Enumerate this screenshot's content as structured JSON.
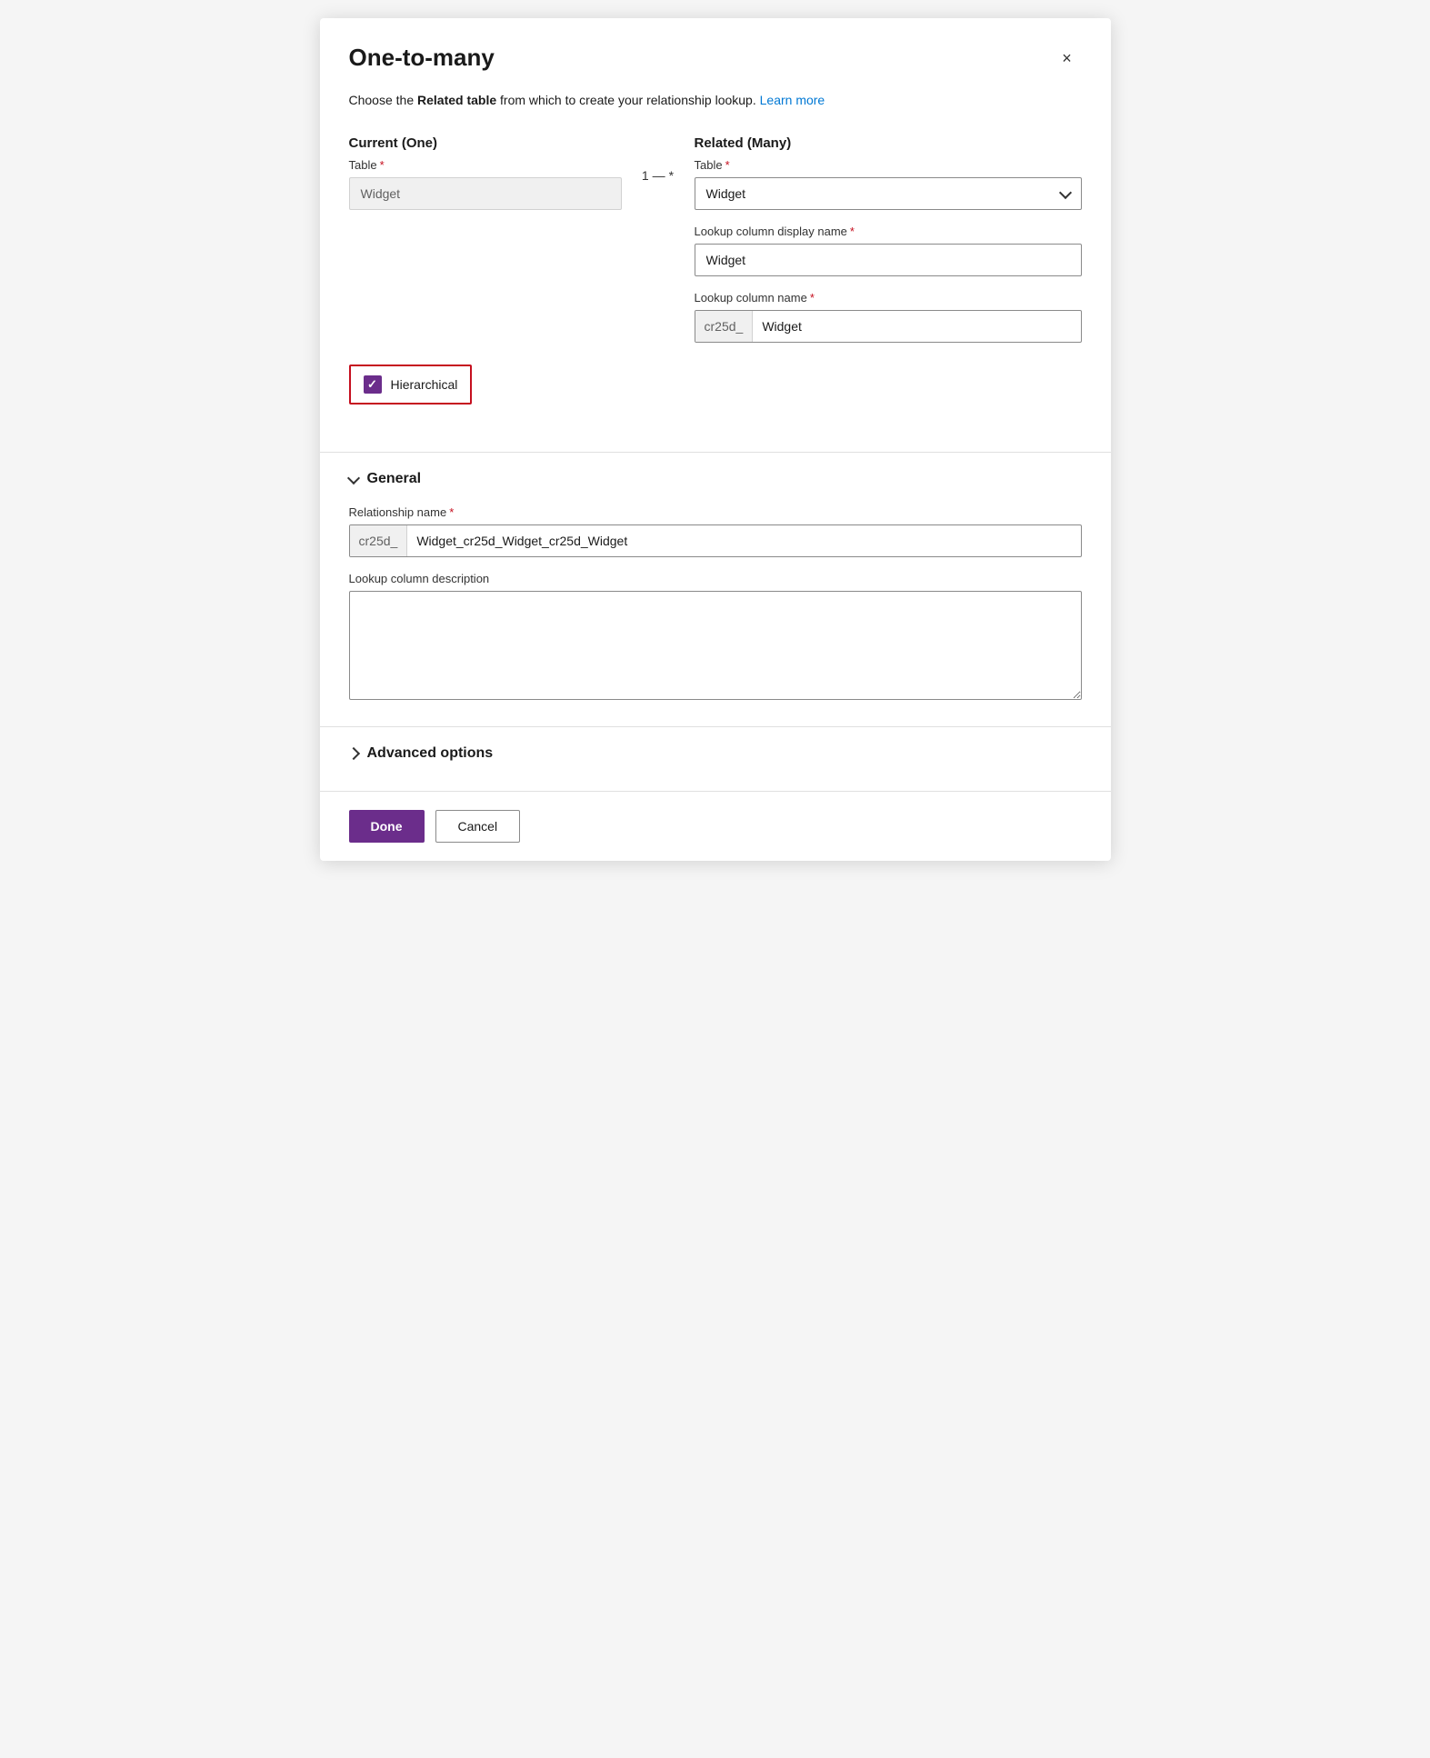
{
  "dialog": {
    "title": "One-to-many",
    "close_label": "×"
  },
  "description": {
    "text_before": "Choose the ",
    "bold_text": "Related table",
    "text_after": " from which to create your relationship lookup.",
    "learn_more_label": "Learn more"
  },
  "current_section": {
    "header": "Current (One)",
    "table_label": "Table",
    "table_value": "Widget"
  },
  "connector": {
    "left": "1",
    "dash": "—",
    "right": "*"
  },
  "related_section": {
    "header": "Related (Many)",
    "table_label": "Table",
    "table_value": "Widget",
    "lookup_display_label": "Lookup column display name",
    "lookup_display_value": "Widget",
    "lookup_name_label": "Lookup column name",
    "lookup_name_prefix": "cr25d_",
    "lookup_name_value": "Widget"
  },
  "hierarchical": {
    "label": "Hierarchical",
    "checked": true
  },
  "general_section": {
    "toggle_label": "General",
    "relationship_name_label": "Relationship name",
    "relationship_name_prefix": "cr25d_",
    "relationship_name_value": "Widget_cr25d_Widget_cr25d_Widget",
    "description_label": "Lookup column description",
    "description_value": ""
  },
  "advanced_section": {
    "toggle_label": "Advanced options"
  },
  "footer": {
    "done_label": "Done",
    "cancel_label": "Cancel"
  }
}
